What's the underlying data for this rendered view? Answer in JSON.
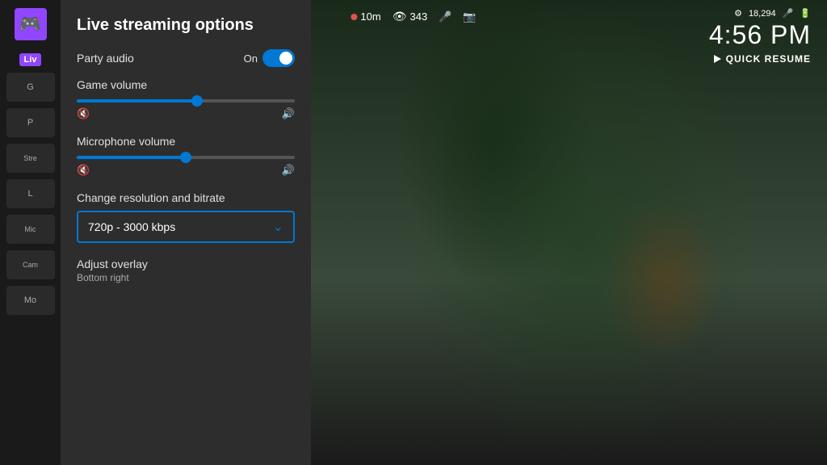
{
  "panel": {
    "title": "Live streaming options",
    "party_audio": {
      "label": "Party audio",
      "toggle_state": "On"
    },
    "game_volume": {
      "label": "Game volume",
      "value_percent": 55
    },
    "microphone_volume": {
      "label": "Microphone volume",
      "value_percent": 50
    },
    "resolution": {
      "label": "Change resolution and bitrate",
      "selected": "720p - 3000 kbps"
    },
    "adjust_overlay": {
      "label": "Adjust overlay",
      "subtitle": "Bottom right"
    }
  },
  "hud": {
    "time_live": "10m",
    "viewers": "343",
    "clock": "4:56 PM",
    "score": "18,294"
  },
  "quick_resume": {
    "label": "QUICK RESUME"
  },
  "sidebar": {
    "live_label": "Liv",
    "items": [
      {
        "label": "G"
      },
      {
        "label": "P"
      },
      {
        "label": "Stre"
      },
      {
        "label": "L"
      },
      {
        "label": "Mic"
      },
      {
        "label": "Cam"
      },
      {
        "label": "Mo"
      }
    ]
  }
}
